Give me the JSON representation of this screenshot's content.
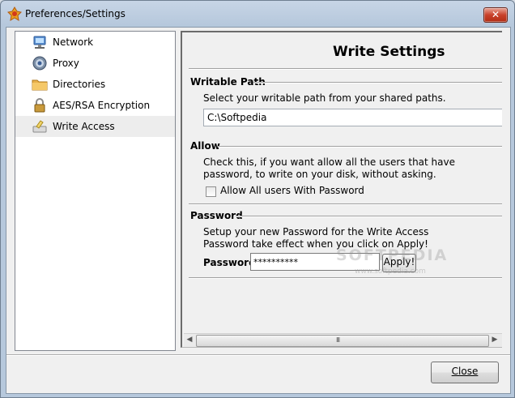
{
  "window": {
    "title": "Preferences/Settings"
  },
  "sidebar": {
    "items": [
      {
        "label": "Network",
        "icon": "network-icon"
      },
      {
        "label": "Proxy",
        "icon": "proxy-icon"
      },
      {
        "label": "Directories",
        "icon": "folder-icon"
      },
      {
        "label": "AES/RSA Encryption",
        "icon": "lock-icon"
      },
      {
        "label": "Write Access",
        "icon": "write-access-icon",
        "selected": true
      }
    ]
  },
  "panel": {
    "title": "Write Settings",
    "writable_path": {
      "heading": "Writable Path",
      "description": "Select your writable path from your shared paths.",
      "value": "C:\\Softpedia"
    },
    "allow": {
      "heading": "Allow",
      "description_line1": "Check this, if you want allow all the users that have",
      "description_line2": "password, to write on your disk, without asking.",
      "checkbox_label": "Allow All users With Password",
      "checked": false
    },
    "password": {
      "heading": "Password",
      "description_line1": "Setup your new Password for the Write Access",
      "description_line2": "Password take effect when you click on Apply!",
      "label": "Password:",
      "value": "**********",
      "apply_label": "Apply!"
    },
    "scrollbar": {
      "grip": "III"
    },
    "watermark": {
      "text": "SOFTPEDIA",
      "url": "www.softpedia.com"
    }
  },
  "footer": {
    "close_label": "Close"
  },
  "colors": {
    "title_bar": "#b6c8dc",
    "close_button": "#c8412b",
    "selected_row": "#ededed"
  }
}
